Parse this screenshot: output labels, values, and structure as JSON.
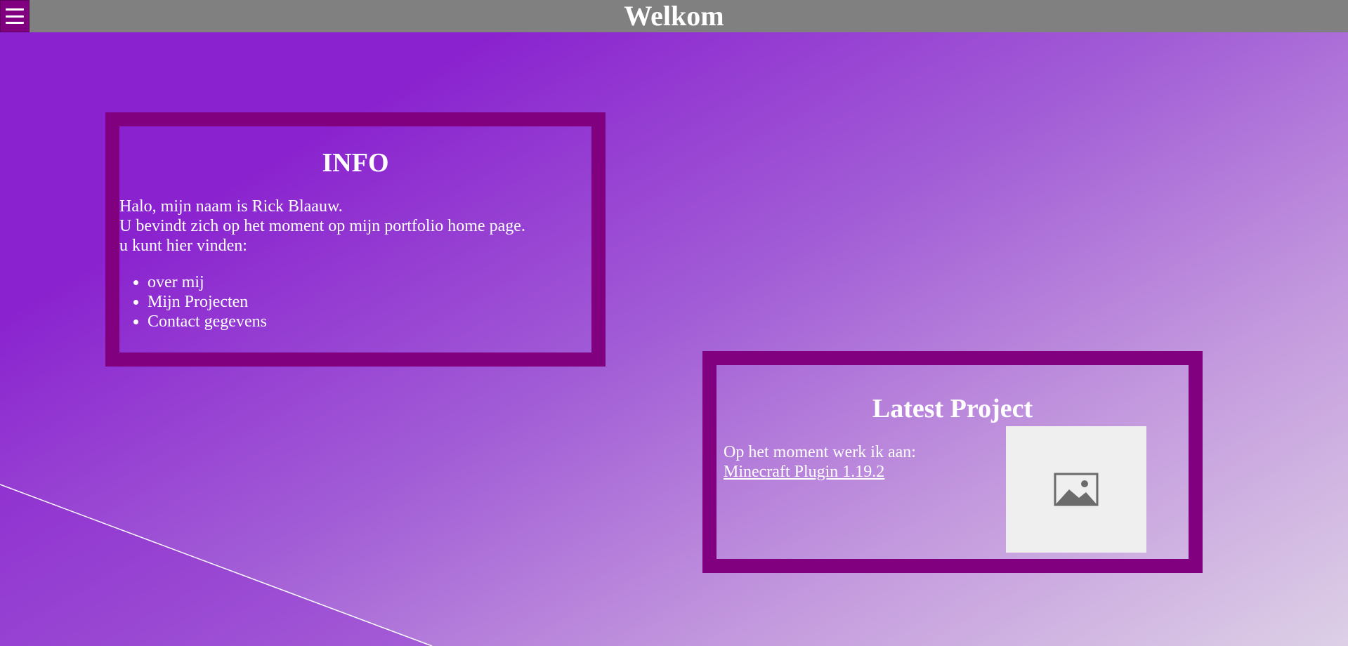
{
  "header": {
    "title": "Welkom",
    "menu_icon": "hamburger-menu-icon"
  },
  "info": {
    "heading": "INFO",
    "intro_lines": [
      "Halo, mijn naam is Rick Blaauw.",
      "U bevindt zich op het moment op mijn portfolio home page.",
      "u kunt hier vinden:"
    ],
    "list_items": [
      "over mij",
      "Mijn Projecten",
      "Contact gegevens"
    ]
  },
  "latest_project": {
    "heading": "Latest Project",
    "text": "Op het moment werk ik aan:",
    "link_label": "Minecraft Plugin 1.19.2",
    "image_icon": "image-placeholder-icon"
  },
  "colors": {
    "header_bg": "#808080",
    "card_border": "#800080",
    "menu_button_bg": "#800080",
    "gradient_start": "#8a22cf",
    "gradient_end": "#ddd0e6",
    "image_bg": "#efefef",
    "text": "#ffffff"
  }
}
